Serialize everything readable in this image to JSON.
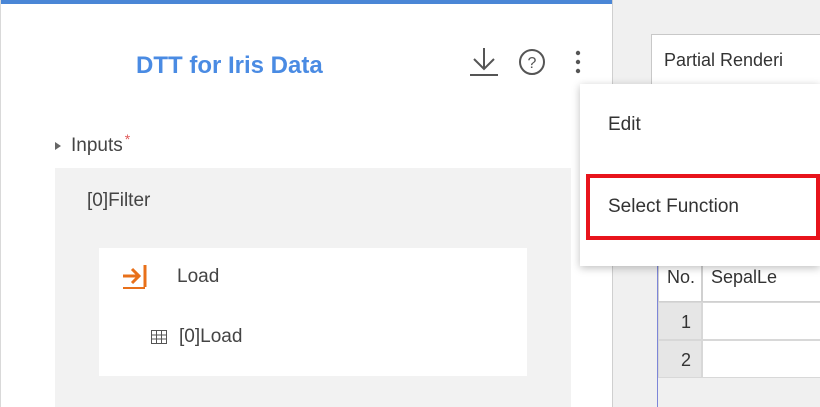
{
  "panel": {
    "title": "DTT for Iris Data",
    "icons": [
      "download-icon",
      "help-icon",
      "more-vertical-icon"
    ]
  },
  "inputs": {
    "label": "Inputs",
    "required_marker": "*"
  },
  "filter": {
    "label": "[0]Filter",
    "load": {
      "label": "Load",
      "sub_label": "[0]Load"
    }
  },
  "right": {
    "tab_label": "Partial Renderi",
    "grid": {
      "headers": [
        "No.",
        "SepalLe"
      ],
      "rows": [
        "1",
        "2"
      ]
    }
  },
  "context_menu": {
    "items": [
      "Edit",
      "Select Function"
    ],
    "highlighted": "Select Function"
  },
  "colors": {
    "title": "#4a8be3",
    "accent_bar": "#4a86d6",
    "load_icon": "#e8701a",
    "highlight_border": "#e8141c",
    "required": "#e05a5a"
  }
}
